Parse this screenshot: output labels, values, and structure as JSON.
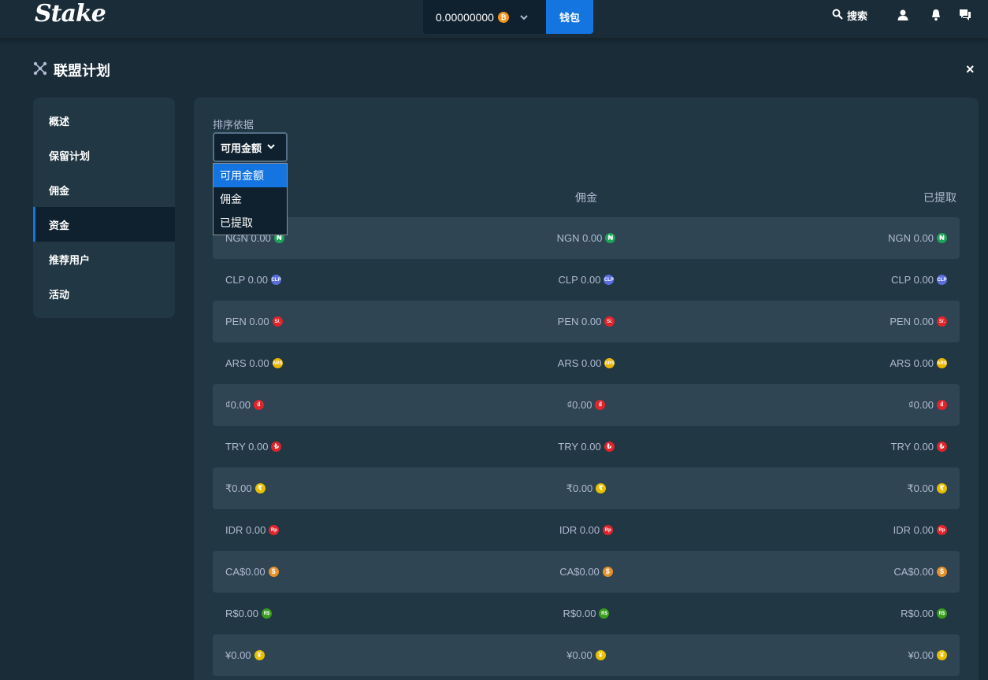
{
  "topbar": {
    "logo": "Stake",
    "balance": "0.00000000",
    "wallet": "钱包",
    "search": "搜索"
  },
  "page": {
    "title": "联盟计划",
    "close": "×"
  },
  "sidebar": {
    "items": [
      {
        "label": "概述"
      },
      {
        "label": "保留计划"
      },
      {
        "label": "佣金"
      },
      {
        "label": "资金"
      },
      {
        "label": "推荐用户"
      },
      {
        "label": "活动"
      }
    ]
  },
  "main": {
    "sort_label": "排序依据",
    "sort_value": "可用金额",
    "sort_options": [
      "可用金额",
      "佣金",
      "已提取"
    ],
    "columns": [
      "佣金",
      "已提取"
    ],
    "rows": [
      {
        "amount": "NGN 0.00",
        "icon": "₦",
        "color": "#1fa25a"
      },
      {
        "amount": "CLP 0.00",
        "icon": "CLP",
        "color": "#5b6ee0"
      },
      {
        "amount": "PEN 0.00",
        "icon": "S/.",
        "color": "#e0242c"
      },
      {
        "amount": "ARS 0.00",
        "icon": "ARS",
        "color": "#e8b500"
      },
      {
        "amount": "₫0.00",
        "icon": "₫",
        "color": "#e0242c"
      },
      {
        "amount": "TRY 0.00",
        "icon": "₺",
        "color": "#e0242c"
      },
      {
        "amount": "₹0.00",
        "icon": "₹",
        "color": "#e8c000"
      },
      {
        "amount": "IDR 0.00",
        "icon": "Rp",
        "color": "#e0242c"
      },
      {
        "amount": "CA$0.00",
        "icon": "$",
        "color": "#e8902a"
      },
      {
        "amount": "R$0.00",
        "icon": "R$",
        "color": "#3a9e1e"
      },
      {
        "amount": "¥0.00",
        "icon": "¥",
        "color": "#e8c000"
      }
    ]
  }
}
